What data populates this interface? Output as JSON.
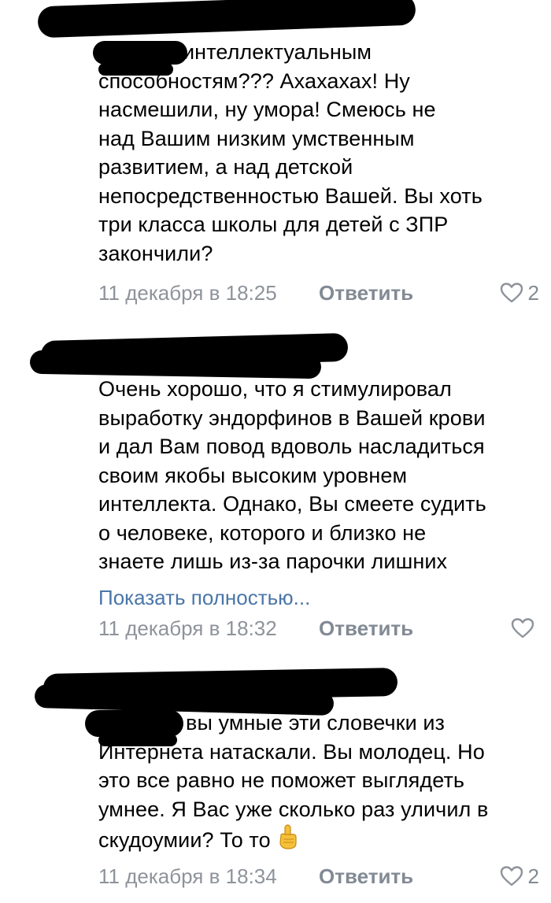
{
  "comments": [
    {
      "lines": [
        "интеллектуальным",
        "способностям??? Ахахахах! Ну",
        "насмешили, ну умора! Смеюсь не",
        "над Вашим низким умственным",
        "развитием, а над детской",
        "непосредственностью Вашей. Вы хоть",
        "три класса школы для детей с ЗПР",
        "закончили?"
      ],
      "date": "11 декабря в 18:25",
      "reply": "Ответить",
      "likes": "2"
    },
    {
      "lines": [
        "Очень хорошо, что я стимулировал",
        "выработку эндорфинов в Вашей крови",
        "и дал Вам повод вдоволь насладиться",
        "своим якобы высоким уровнем",
        "интеллекта. Однако, Вы смеете судить",
        "о человеке, которого и близко не",
        "знаете лишь из-за парочки лишних"
      ],
      "show_more": "Показать полностью...",
      "date": "11 декабря в 18:32",
      "reply": "Ответить",
      "likes": ""
    },
    {
      "lines": [
        "вы умные эти словечки из",
        "Интернета натаскали. Вы молодец. Но",
        "это все равно не поможет выглядеть",
        "умнее. Я Вас уже сколько раз уличил в",
        "скудоумии? То то"
      ],
      "date": "11 декабря в 18:34",
      "reply": "Ответить",
      "likes": "2"
    }
  ],
  "icons": {
    "like": "heart-outline-icon",
    "emoji": "pointing-up-emoji"
  },
  "colors": {
    "link": "#4a76a8",
    "meta": "#8e939a",
    "redaction": "#000000"
  }
}
